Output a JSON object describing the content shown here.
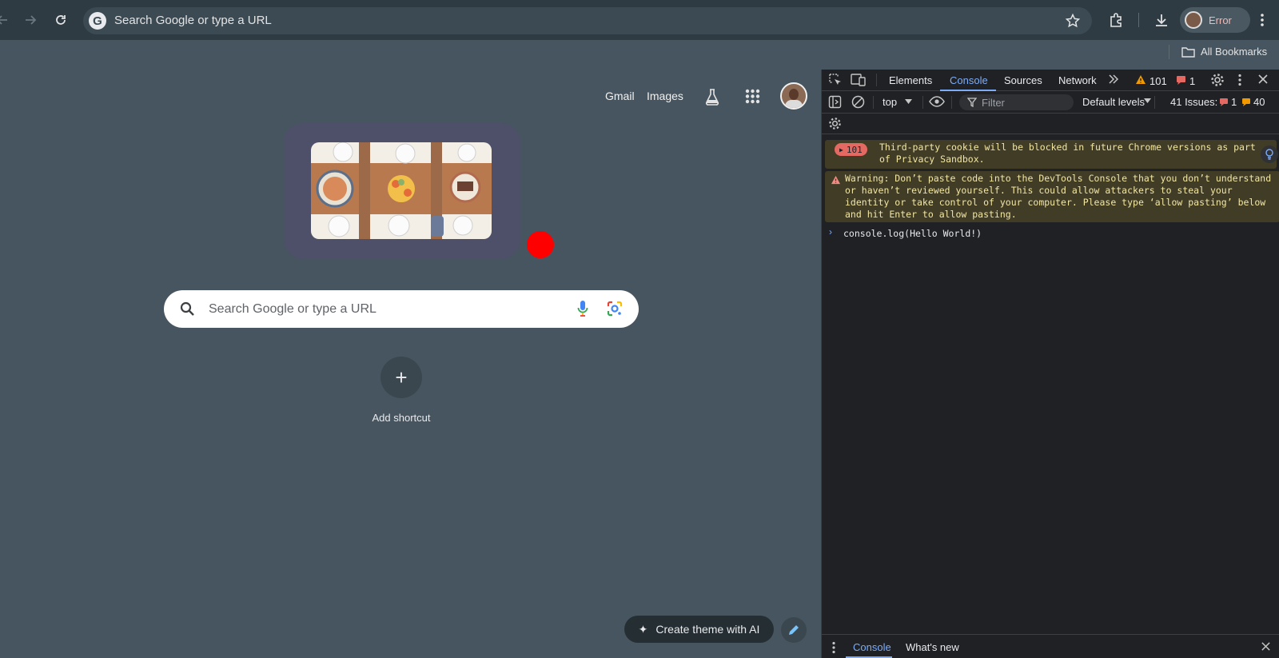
{
  "browser": {
    "omnibox_text": "Search Google or type a URL",
    "profile_label": "Error",
    "bookmarks_label": "All Bookmarks"
  },
  "ntp": {
    "links": {
      "gmail": "Gmail",
      "images": "Images"
    },
    "search_placeholder": "Search Google or type a URL",
    "add_shortcut_label": "Add shortcut",
    "theme_button_label": "Create theme with AI"
  },
  "devtools": {
    "tabs": [
      "Elements",
      "Console",
      "Sources",
      "Network"
    ],
    "active_tab": "Console",
    "warning_count": "101",
    "error_count": "1",
    "context_select": "top",
    "filter_placeholder": "Filter",
    "levels_select": "Default levels",
    "issues": {
      "label": "41 Issues:",
      "errors": "1",
      "warnings": "40"
    },
    "messages": [
      {
        "type": "issue",
        "badge": "101",
        "text": "Third-party cookie will be blocked in future Chrome versions as part of Privacy Sandbox."
      },
      {
        "type": "warning",
        "text": "Warning: Don’t paste code into the DevTools Console that you don’t understand or haven’t reviewed yourself. This could allow attackers to steal your identity or take control of your computer. Please type ‘allow pasting’ below and hit Enter to allow pasting."
      }
    ],
    "console_input": "console.log(Hello World!)",
    "drawer_tabs": [
      "Console",
      "What's new"
    ]
  },
  "colors": {
    "page_bg": "#46555f",
    "accent": "#7cacf8",
    "warning_bg": "#413c26",
    "recording_dot": "#ff0000"
  }
}
